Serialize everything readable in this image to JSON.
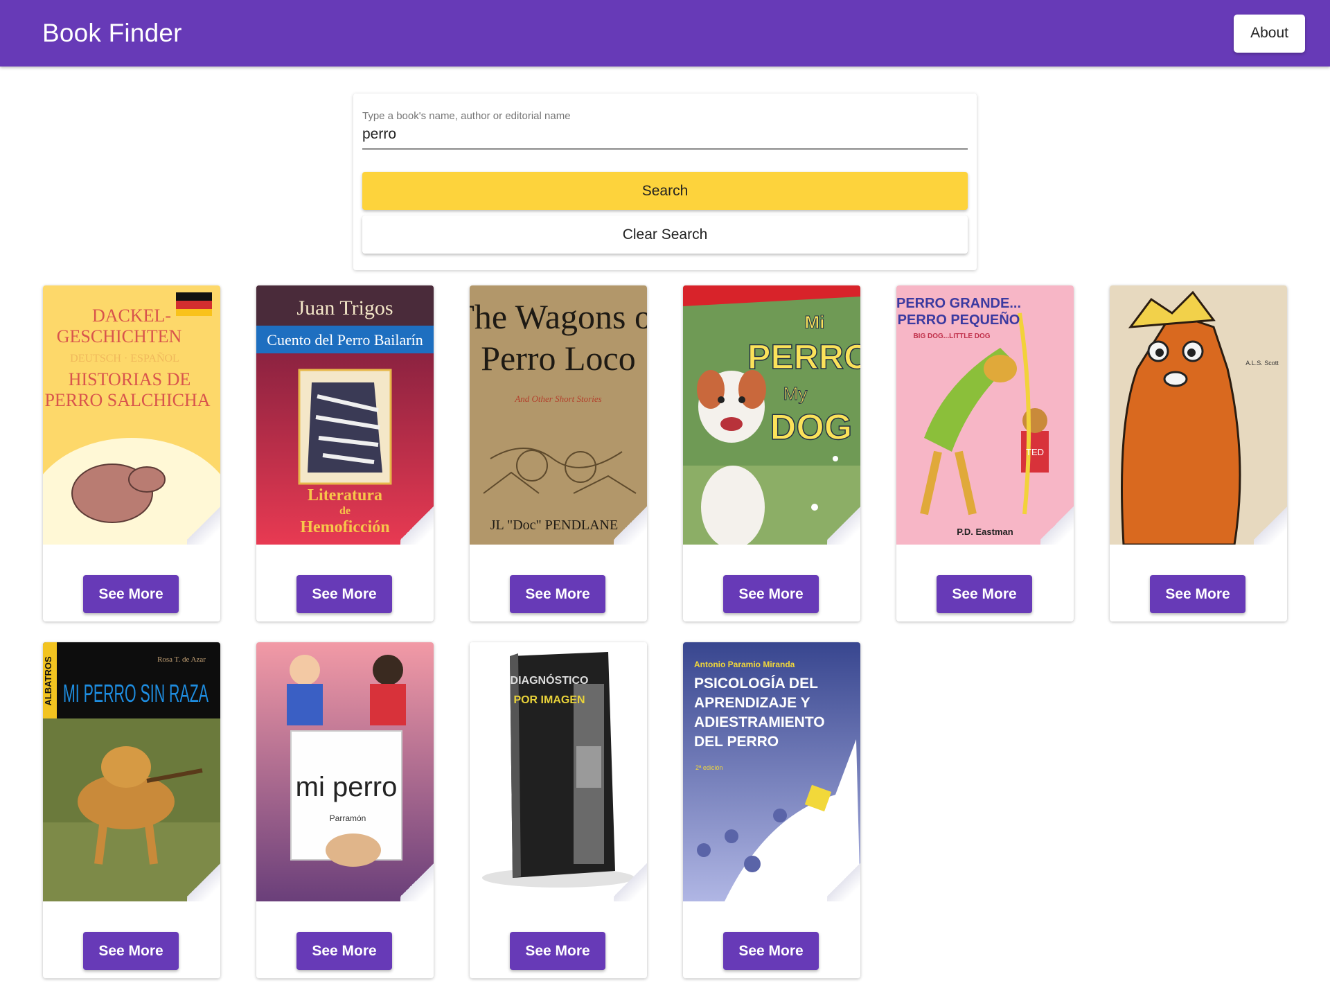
{
  "header": {
    "title": "Book Finder",
    "about_label": "About"
  },
  "search": {
    "label": "Type a book's name, author or editorial name",
    "value": "perro",
    "search_label": "Search",
    "clear_label": "Clear Search"
  },
  "books": [
    {
      "cover_lines": [
        "DACKEL-",
        "GESCHICHTEN",
        "DEUTSCH · ESPAÑOL",
        "HISTORIAS DE",
        "PERRO SALCHICHA"
      ],
      "button": "See More"
    },
    {
      "cover_lines": [
        "Juan Trigos",
        "Cuento del Perro Bailarín",
        "Literatura",
        "de",
        "Hemoficción"
      ],
      "button": "See More"
    },
    {
      "cover_lines": [
        "The Wagons of",
        "Perro Loco",
        "And Other Short Stories",
        "JL \"Doc\" PENDLANE"
      ],
      "button": "See More"
    },
    {
      "cover_lines": [
        "Mi",
        "PERRO",
        "My",
        "DOG"
      ],
      "button": "See More"
    },
    {
      "cover_lines": [
        "PERRO GRANDE...",
        "PERRO PEQUEÑO",
        "BIG DOG...LITTLE DOG",
        "TED",
        "P.D. Eastman"
      ],
      "button": "See More"
    },
    {
      "cover_lines": [
        "A.L.S. Scott"
      ],
      "button": "See More"
    },
    {
      "cover_lines": [
        "ALBATROS",
        "Rosa T. de Azar",
        "MI PERRO SIN RAZA"
      ],
      "button": "See More"
    },
    {
      "cover_lines": [
        "mi perro",
        "Parramón"
      ],
      "button": "See More"
    },
    {
      "cover_lines": [
        "DIAGNÓSTICO",
        "POR IMAGEN"
      ],
      "button": "See More"
    },
    {
      "cover_lines": [
        "Antonio Paramio Miranda",
        "PSICOLOGÍA DEL",
        "APRENDIZAJE Y",
        "ADIESTRAMIENTO",
        "DEL PERRO",
        "2ª edición"
      ],
      "button": "See More"
    }
  ]
}
